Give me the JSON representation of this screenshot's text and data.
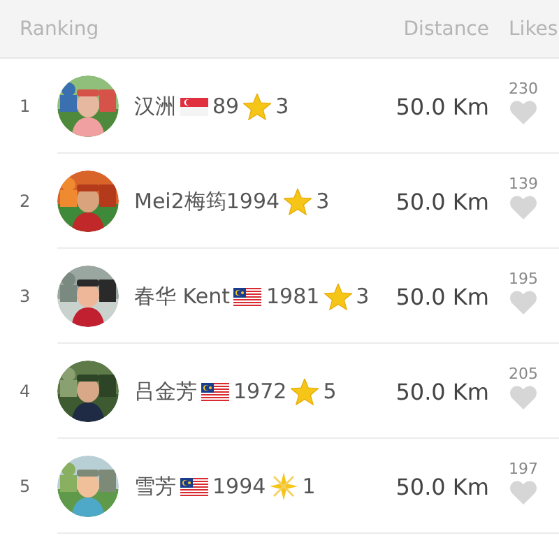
{
  "header": {
    "ranking": "Ranking",
    "distance": "Distance",
    "likes": "Likes"
  },
  "rows": [
    {
      "rank": "1",
      "name": [
        {
          "kind": "text",
          "text": "汉洲"
        },
        {
          "kind": "flag-sg"
        },
        {
          "kind": "text",
          "text": "89"
        },
        {
          "kind": "star"
        },
        {
          "kind": "text",
          "text": "3"
        }
      ],
      "distance": "50.0 Km",
      "likes": "230"
    },
    {
      "rank": "2",
      "name": [
        {
          "kind": "text",
          "text": "Mei2梅筠1994"
        },
        {
          "kind": "star"
        },
        {
          "kind": "text",
          "text": "3"
        }
      ],
      "distance": "50.0 Km",
      "likes": "139"
    },
    {
      "rank": "3",
      "name": [
        {
          "kind": "text",
          "text": "春华 Kent"
        },
        {
          "kind": "flag-my"
        },
        {
          "kind": "text",
          "text": "1981"
        },
        {
          "kind": "star"
        },
        {
          "kind": "text",
          "text": "3"
        }
      ],
      "distance": "50.0 Km",
      "likes": "195"
    },
    {
      "rank": "4",
      "name": [
        {
          "kind": "text",
          "text": "吕金芳"
        },
        {
          "kind": "flag-my"
        },
        {
          "kind": "text",
          "text": "1972"
        },
        {
          "kind": "star"
        },
        {
          "kind": "text",
          "text": "5"
        }
      ],
      "distance": "50.0 Km",
      "likes": "205"
    },
    {
      "rank": "5",
      "name": [
        {
          "kind": "text",
          "text": "雪芳"
        },
        {
          "kind": "flag-my"
        },
        {
          "kind": "text",
          "text": "1994"
        },
        {
          "kind": "sparkle"
        },
        {
          "kind": "text",
          "text": "1"
        }
      ],
      "distance": "50.0 Km",
      "likes": "197"
    }
  ]
}
